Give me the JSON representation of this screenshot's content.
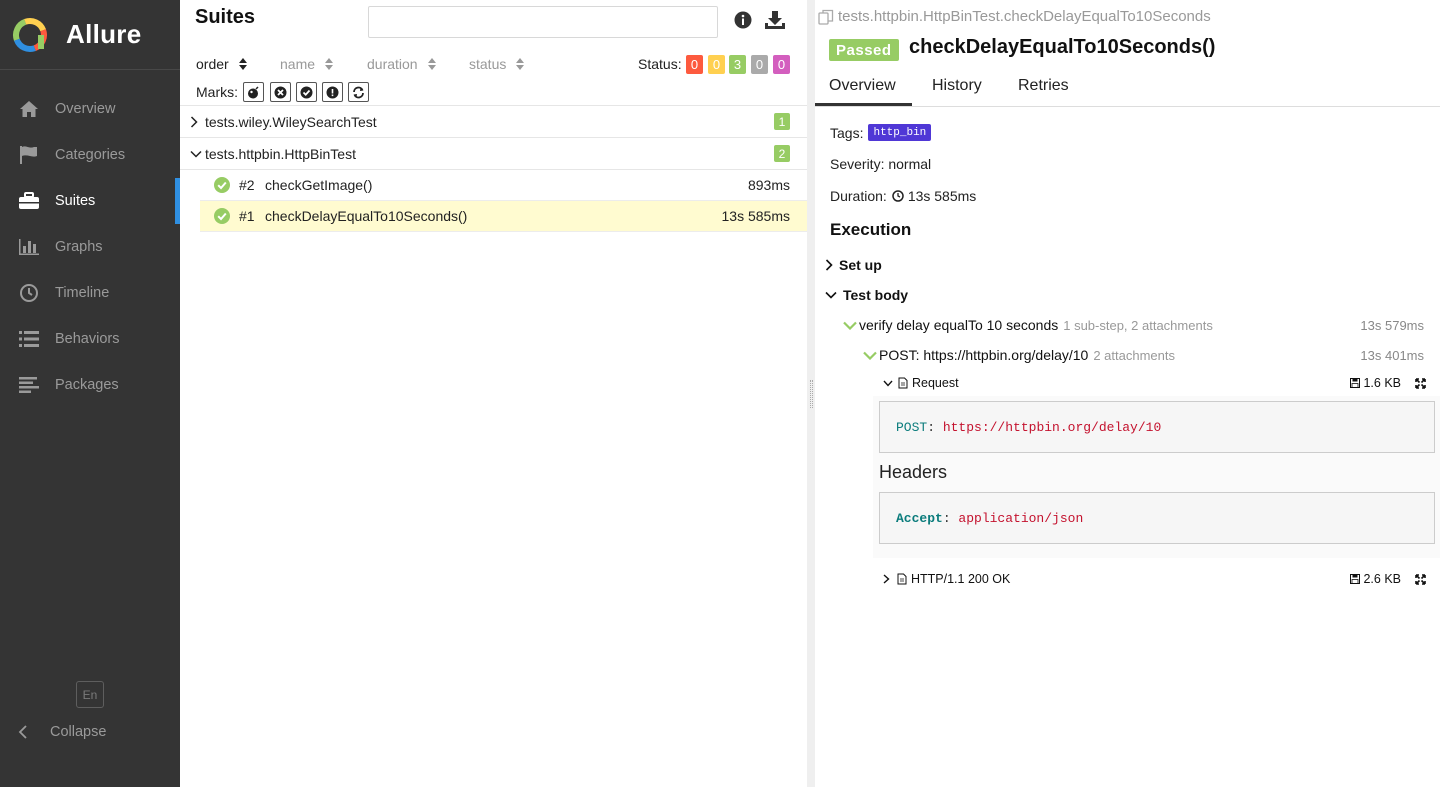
{
  "app": {
    "name": "Allure"
  },
  "sidebar": {
    "items": [
      {
        "label": "Overview",
        "icon": "home-icon"
      },
      {
        "label": "Categories",
        "icon": "flag-icon"
      },
      {
        "label": "Suites",
        "icon": "briefcase-icon",
        "active": true
      },
      {
        "label": "Graphs",
        "icon": "bar-chart-icon"
      },
      {
        "label": "Timeline",
        "icon": "clock-icon"
      },
      {
        "label": "Behaviors",
        "icon": "list-icon"
      },
      {
        "label": "Packages",
        "icon": "align-left-icon"
      }
    ],
    "language": "En",
    "collapse_label": "Collapse"
  },
  "suites": {
    "title": "Suites",
    "search_value": "",
    "sorters": [
      {
        "label": "order",
        "active": true
      },
      {
        "label": "name",
        "active": false
      },
      {
        "label": "duration",
        "active": false
      },
      {
        "label": "status",
        "active": false
      }
    ],
    "status_label": "Status:",
    "status_counts": [
      {
        "status": "failed",
        "count": "0",
        "color": "#fd5a3e"
      },
      {
        "status": "broken",
        "count": "0",
        "color": "#ffd050"
      },
      {
        "status": "passed",
        "count": "3",
        "color": "#97cc64"
      },
      {
        "status": "skipped",
        "count": "0",
        "color": "#aaaaaa"
      },
      {
        "status": "unknown",
        "count": "0",
        "color": "#d35ebe"
      }
    ],
    "marks_label": "Marks:",
    "marks": [
      "flaky-icon",
      "new-failed-icon",
      "new-passed-icon",
      "new-broken-icon",
      "retries-icon"
    ],
    "groups": [
      {
        "name": "tests.wiley.WileySearchTest",
        "count": "1",
        "expanded": false
      },
      {
        "name": "tests.httpbin.HttpBinTest",
        "count": "2",
        "expanded": true
      }
    ],
    "tests": [
      {
        "order": "#2",
        "name": "checkGetImage()",
        "duration": "893ms",
        "selected": false
      },
      {
        "order": "#1",
        "name": "checkDelayEqualTo10Seconds()",
        "duration": "13s 585ms",
        "selected": true
      }
    ]
  },
  "testcase": {
    "breadcrumb": "tests.httpbin.HttpBinTest.checkDelayEqualTo10Seconds",
    "status": "Passed",
    "status_color": "#97cc64",
    "title": "checkDelayEqualTo10Seconds()",
    "tabs": [
      "Overview",
      "History",
      "Retries"
    ],
    "tags_label": "Tags:",
    "tag": "http_bin",
    "tag_color": "#4f37d6",
    "severity": "Severity: normal",
    "duration_label": "Duration:",
    "duration": "13s 585ms",
    "execution_title": "Execution",
    "setup_label": "Set up",
    "body_label": "Test body",
    "step1": {
      "name": "verify delay equalTo 10 seconds",
      "meta": "1 sub-step, 2 attachments",
      "duration": "13s 579ms"
    },
    "step2": {
      "name": "POST: https://httpbin.org/delay/10",
      "meta": "2 attachments",
      "duration": "13s 401ms"
    },
    "attachments": [
      {
        "name": "Request",
        "size": "1.6 KB",
        "expanded": true
      },
      {
        "name": "HTTP/1.1 200 OK",
        "size": "2.6 KB",
        "expanded": false
      }
    ],
    "request": {
      "method_key": "POST",
      "url": "https://httpbin.org/delay/10",
      "headers_title": "Headers",
      "header_key": "Accept",
      "header_value": "application/json"
    }
  }
}
